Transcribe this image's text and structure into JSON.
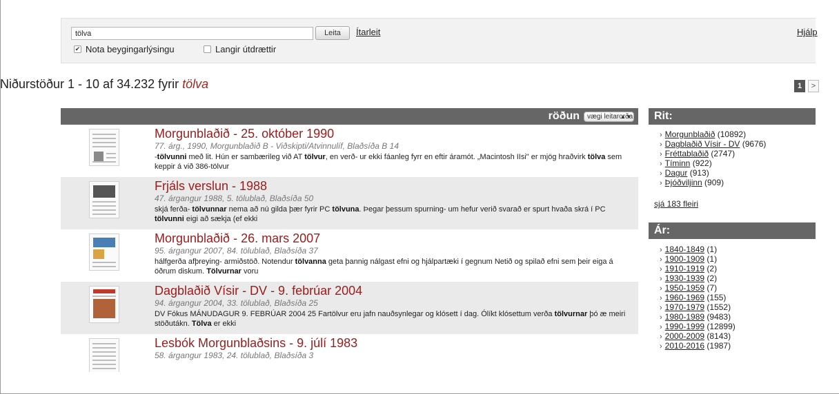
{
  "search": {
    "value": "tölva",
    "button": "Leita",
    "advanced": "Ítarleit",
    "help": "Hjálp",
    "opt_inflection": "Nota beygingarlýsingu",
    "opt_long": "Langir útdrættir",
    "opt_inflection_checked": true,
    "opt_long_checked": false
  },
  "results_header": {
    "prefix": "Niðurstöður 1 - 10 af 34.232 fyrir ",
    "term": "tölva",
    "page": "1",
    "next": ">"
  },
  "sort": {
    "label": "röðun",
    "selected": "vægi leitarorða"
  },
  "results": [
    {
      "title": "Morgunblaðið - 25. október 1990",
      "sub": "77. árg., 1990, Morgunblaðið B - Viðskipti/Atvinnulíf, Blaðsíða B 14",
      "snippet": [
        {
          "t": "-",
          "b": false
        },
        {
          "t": "tölvunni",
          "b": true
        },
        {
          "t": " með lit. Hún er sambærileg við AT ",
          "b": false
        },
        {
          "t": "tölvur",
          "b": true
        },
        {
          "t": ", en verð- ur ekki fáanleg fyrr en eftir áramót. „Macintosh IIsi\" er mjög hraðvirk ",
          "b": false
        },
        {
          "t": "tölva",
          "b": true
        },
        {
          "t": " sem keppir á við 386-tölvur",
          "b": false
        }
      ]
    },
    {
      "title": "Frjáls verslun - 1988",
      "sub": "47. árgangur 1988, 5. tölublað, Blaðsíða 50",
      "snippet": [
        {
          "t": "skjá ferða- ",
          "b": false
        },
        {
          "t": "tölvunnar",
          "b": true
        },
        {
          "t": " nema að nú gilda þær fyrir PC ",
          "b": false
        },
        {
          "t": "tölvuna",
          "b": true
        },
        {
          "t": ". Þegar þessum spurning- um hefur verið svarað er spurt hvaða skrá í PC ",
          "b": false
        },
        {
          "t": "tölvunni",
          "b": true
        },
        {
          "t": " eigi að sækja (ef ekki",
          "b": false
        }
      ]
    },
    {
      "title": "Morgunblaðið - 26. mars 2007",
      "sub": "95. árgangur 2007, 84. tölublað, Blaðsíða 37",
      "snippet": [
        {
          "t": "hálfgerða afþreying- armiðstöð. Notendur ",
          "b": false
        },
        {
          "t": "tölvanna",
          "b": true
        },
        {
          "t": " geta þannig nálgast efni og hjálpartæki í gegnum Netið og spilað efni sem þeir eiga á öðrum diskum. ",
          "b": false
        },
        {
          "t": "Tölvurnar",
          "b": true
        },
        {
          "t": " voru",
          "b": false
        }
      ]
    },
    {
      "title": "Dagblaðið Vísir - DV - 9. febrúar 2004",
      "sub": "94. árgangur 2004, 33. tölublað, Blaðsíða 25",
      "snippet": [
        {
          "t": "DV Fókus MÁNUDAGUR 9. FEBRÚAR 2004 25 Fartölvur eru jafn nauðsynlegar og klósett í dag. Ólíkt klósettum verða ",
          "b": false
        },
        {
          "t": "tölvurnar",
          "b": true
        },
        {
          "t": " þó æ meiri stöðutákn. ",
          "b": false
        },
        {
          "t": "Tölva",
          "b": true
        },
        {
          "t": " er ekki",
          "b": false
        }
      ]
    },
    {
      "title": "Lesbók Morgunblaðsins - 9. júlí 1983",
      "sub": "58. árgangur 1983, 24. tölublað, Blaðsíða 3",
      "snippet": []
    }
  ],
  "sidebar": {
    "rit_title": "Rit:",
    "rit": [
      {
        "name": "Morgunblaðið",
        "count": "(10892)"
      },
      {
        "name": "Dagblaðið Vísir - DV",
        "count": "(9676)"
      },
      {
        "name": "Fréttablaðið",
        "count": "(2747)"
      },
      {
        "name": "Tíminn",
        "count": "(922)"
      },
      {
        "name": "Dagur",
        "count": "(913)"
      },
      {
        "name": "Þjóðviljinn",
        "count": "(909)"
      }
    ],
    "more": "sjá 183 fleiri",
    "ar_title": "Ár:",
    "ar": [
      {
        "name": "1840-1849",
        "count": "(1)"
      },
      {
        "name": "1900-1909",
        "count": "(1)"
      },
      {
        "name": "1910-1919",
        "count": "(2)"
      },
      {
        "name": "1930-1939",
        "count": "(2)"
      },
      {
        "name": "1950-1959",
        "count": "(7)"
      },
      {
        "name": "1960-1969",
        "count": "(155)"
      },
      {
        "name": "1970-1979",
        "count": "(1552)"
      },
      {
        "name": "1980-1989",
        "count": "(9483)"
      },
      {
        "name": "1990-1999",
        "count": "(12899)"
      },
      {
        "name": "2000-2009",
        "count": "(8143)"
      },
      {
        "name": "2010-2016",
        "count": "(1987)"
      }
    ]
  }
}
